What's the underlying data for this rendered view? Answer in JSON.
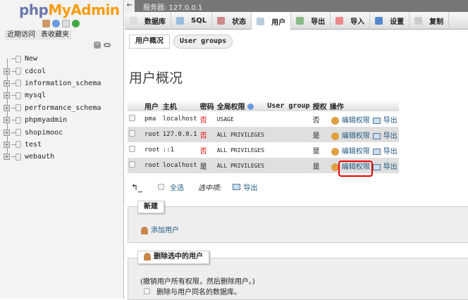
{
  "sidebar": {
    "logo_php": "php",
    "logo_ma": "MyAdmin",
    "recent": "近期访问",
    "favorites": "表收藏夹",
    "tree": [
      "New",
      "cdcol",
      "information_schema",
      "mysql",
      "performance_schema",
      "phpmyadmin",
      "shopimooc",
      "test",
      "webauth"
    ]
  },
  "topbar": {
    "server": "服务器: 127.0.0.1"
  },
  "tabs": [
    "数据库",
    "SQL",
    "状态",
    "用户",
    "导出",
    "导入",
    "设置",
    "复制"
  ],
  "subtabs": [
    "用户概况",
    "User groups"
  ],
  "title": "用户概况",
  "table": {
    "headers": [
      "用户",
      "主机",
      "密码",
      "全局权限",
      "User group",
      "授权",
      "操作"
    ],
    "rows": [
      {
        "user": "pma",
        "host": "localhost",
        "password": "否",
        "priv": "USAGE",
        "group": "",
        "grant": "否",
        "edit": "编辑权限",
        "export": "导出"
      },
      {
        "user": "root",
        "host": "127.0.0.1",
        "password": "否",
        "priv": "ALL PRIVILEGES",
        "group": "",
        "grant": "是",
        "edit": "编辑权限",
        "export": "导出"
      },
      {
        "user": "root",
        "host": "::1",
        "password": "否",
        "priv": "ALL PRIVILEGES",
        "group": "",
        "grant": "是",
        "edit": "编辑权限",
        "export": "导出"
      },
      {
        "user": "root",
        "host": "localhost",
        "password": "是",
        "priv": "ALL PRIVILEGES",
        "group": "",
        "grant": "是",
        "edit": "编辑权限",
        "export": "导出"
      }
    ]
  },
  "footer": {
    "select_all": "全选",
    "with_selected": "选中项:",
    "export": "导出"
  },
  "new_section": {
    "legend": "新建",
    "add_user": "添加用户"
  },
  "delete_section": {
    "legend": "删除选中的用户",
    "note": "(撤销用户所有权限，然后删除用户。)",
    "drop_db": "删除与用户同名的数据库。"
  }
}
